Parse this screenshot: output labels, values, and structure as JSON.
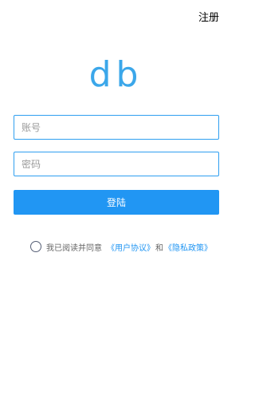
{
  "header": {
    "register_label": "注册"
  },
  "logo": {
    "text": "db"
  },
  "form": {
    "account_placeholder": "账号",
    "password_placeholder": "密码",
    "login_label": "登陆"
  },
  "agreement": {
    "prefix": "我已阅读并同意",
    "user_agreement": "《用户协议》",
    "and": "和",
    "privacy_policy": "《隐私政策》",
    "checked": false
  },
  "colors": {
    "accent": "#2196f3",
    "logo": "#3ba7ea",
    "border": "#2f9ff0"
  }
}
